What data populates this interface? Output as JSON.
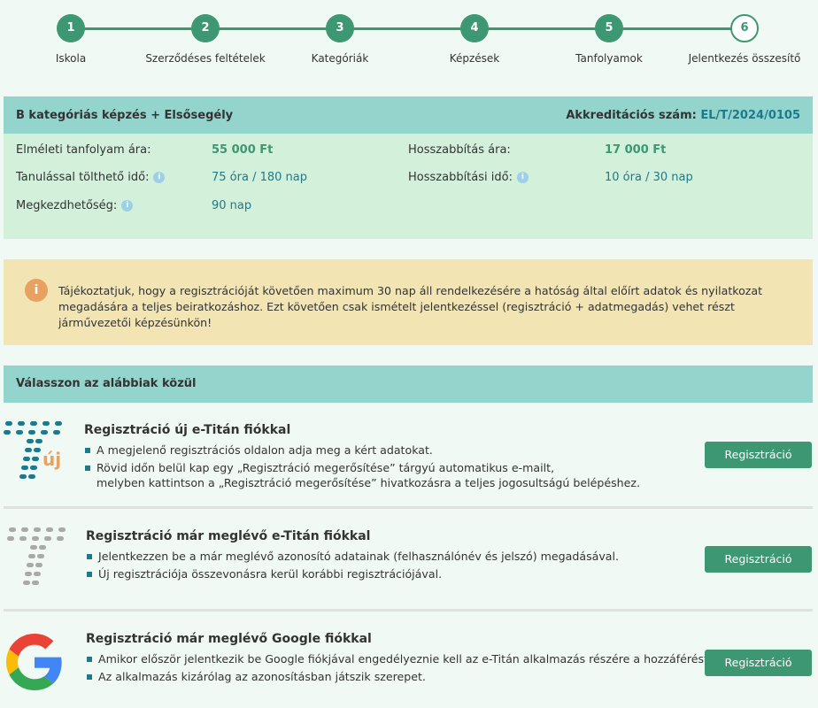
{
  "stepper": {
    "steps": [
      {
        "number": "1",
        "label": "Iskola"
      },
      {
        "number": "2",
        "label": "Szerződéses feltételek"
      },
      {
        "number": "3",
        "label": "Kategóriák"
      },
      {
        "number": "4",
        "label": "Képzések"
      },
      {
        "number": "5",
        "label": "Tanfolyamok"
      },
      {
        "number": "6",
        "label": "Jelentkezés összesítő"
      }
    ],
    "current_step": 6
  },
  "course": {
    "title": "B kategóriás képzés + Elsősegély",
    "accreditation_label": "Akkreditációs szám:",
    "accreditation_number": "EL/T/2024/0105",
    "theory_price_label": "Elméleti tanfolyam ára:",
    "theory_price": "55 000 Ft",
    "study_time_label": "Tanulással tölthető idő:",
    "study_time": "75 óra / 180 nap",
    "start_label": "Megkezdhetőség:",
    "start_value": "90 nap",
    "extension_price_label": "Hosszabbítás ára:",
    "extension_price": "17 000 Ft",
    "extension_time_label": "Hosszabbítási idő:",
    "extension_time": "10 óra / 30 nap"
  },
  "notice": {
    "icon": "info-icon",
    "text": "Tájékoztatjuk, hogy a regisztrációját követően maximum 30 nap áll rendelkezésére a hatóság által előírt adatok és nyilatkozat megadására a teljes beiratkozáshoz. Ezt követően csak ismételt jelentkezéssel (regisztráció + adatmegadás) vehet részt járművezetői képzésünkön!"
  },
  "options_header": "Válasszon az alábbiak közül",
  "options": [
    {
      "title": "Regisztráció új e-Titán fiókkal",
      "logo_text": "új",
      "bullets": [
        "A megjelenő regisztrációs oldalon adja meg a kért adatokat.",
        "Rövid időn belül kap egy „Regisztráció megerősítése” tárgyú automatikus e-mailt,",
        "melyben kattintson a „Regisztráció megerősítése” hivatkozásra a teljes jogosultságú belépéshez."
      ],
      "button": "Regisztráció"
    },
    {
      "title": "Regisztráció már meglévő e-Titán fiókkal",
      "bullets": [
        "Jelentkezzen be a már meglévő azonosító adatainak (felhasználónév és jelszó) megadásával.",
        "Új regisztrációja összevonásra kerül korábbi regisztrációjával."
      ],
      "button": "Regisztráció"
    },
    {
      "title": "Regisztráció már meglévő Google fiókkal",
      "bullets": [
        "Amikor először jelentkezik be Google fiókjával engedélyeznie kell az e-Titán alkalmazás részére a hozzáférést.",
        "Az alkalmazás kizárólag az azonosításban játszik szerepet."
      ],
      "button": "Regisztráció"
    }
  ],
  "colors": {
    "accent": "#3d9772",
    "header_bg": "#93d4cd",
    "card_bg": "#d2f0da",
    "notice_bg": "#f3e5b3",
    "link": "#1d7a8b"
  }
}
